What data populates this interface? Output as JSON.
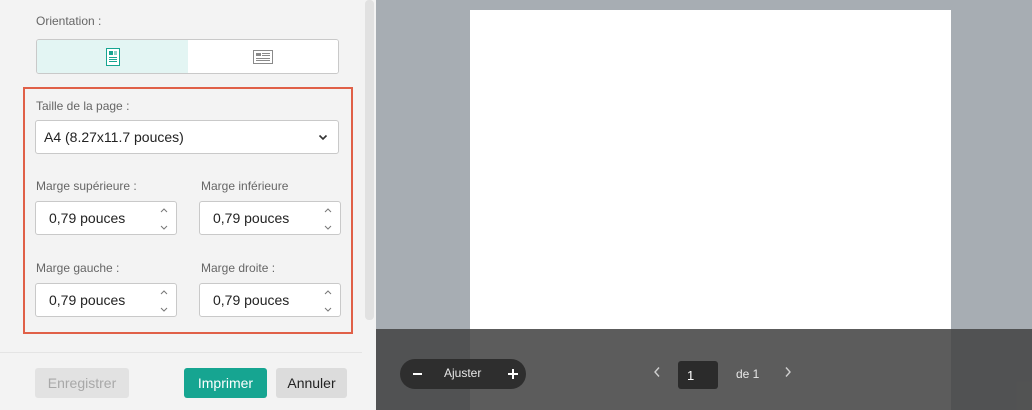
{
  "settings": {
    "orientation_label": "Orientation :",
    "page_size_label": "Taille de la page :",
    "page_size_value": "A4 (8.27x11.7 pouces)",
    "margin_top_label": "Marge supérieure :",
    "margin_top_value": "0,79 pouces",
    "margin_bottom_label": "Marge inférieure",
    "margin_bottom_value": "0,79 pouces",
    "margin_left_label": "Marge gauche :",
    "margin_left_value": "0,79 pouces",
    "margin_right_label": "Marge droite :",
    "margin_right_value": "0,79 pouces"
  },
  "buttons": {
    "save": "Enregistrer",
    "print": "Imprimer",
    "cancel": "Annuler"
  },
  "preview": {
    "zoom_label": "Ajuster",
    "page_number": "1",
    "page_of": "de 1"
  },
  "colors": {
    "accent": "#16a591",
    "highlight_border": "#e06048",
    "preview_bg": "#a7adb3"
  }
}
